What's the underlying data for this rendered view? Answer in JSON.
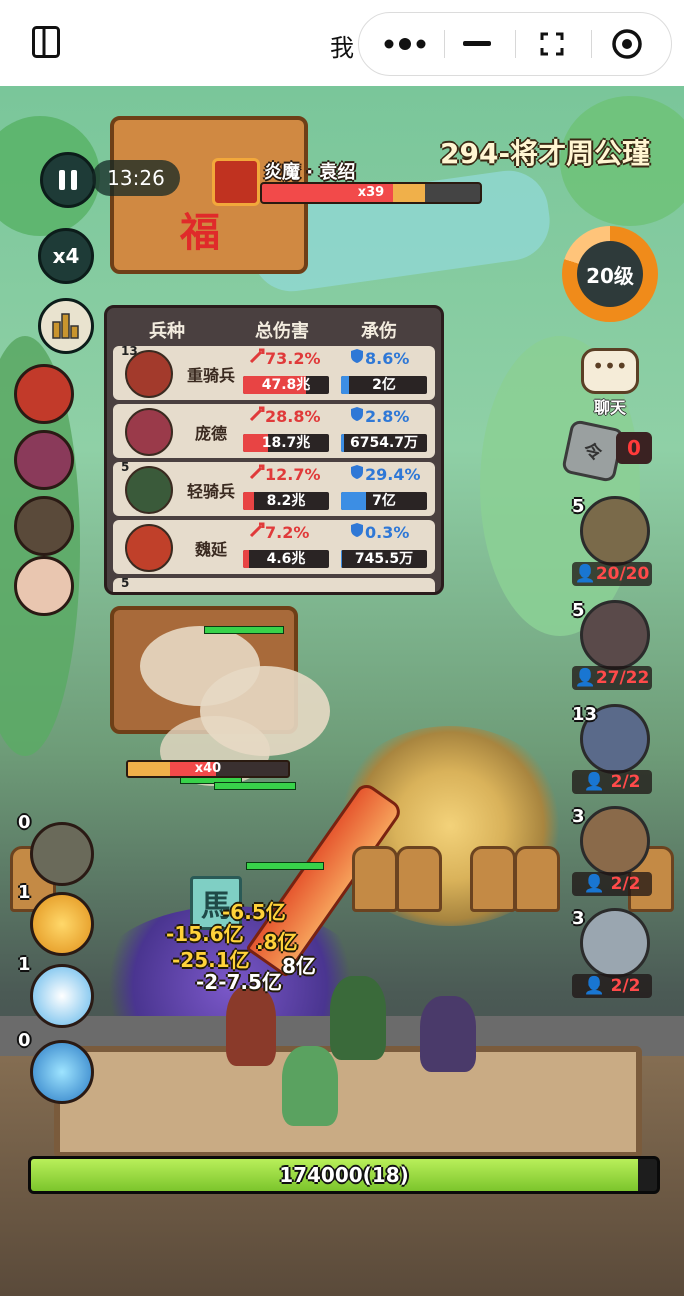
{
  "topbar": {
    "title": "我",
    "menu_icon": "more-dots-icon",
    "minimize_icon": "minimize-icon",
    "close_icon": "record-close-icon"
  },
  "hud": {
    "timer": "13:26",
    "speed_label": "x4",
    "boss": {
      "name": "炎魔 · 袁绍",
      "count": "x39",
      "hp_fraction": 0.6
    },
    "level_title": "294-将才周公瑾",
    "player_level": "20级",
    "chat_label": "聊天",
    "token_count": "0",
    "token_glyph": "令"
  },
  "damage_panel": {
    "headers": [
      "兵种",
      "总伤害",
      "承伤"
    ],
    "rows": [
      {
        "level": "13",
        "name": "重骑兵",
        "dmg_pct": "73.2%",
        "dmg_val": "47.8兆",
        "dmg_fill": 0.73,
        "tank_pct": "8.6%",
        "tank_val": "2亿",
        "tank_fill": 0.09
      },
      {
        "level": "",
        "name": "庞德",
        "dmg_pct": "28.8%",
        "dmg_val": "18.7兆",
        "dmg_fill": 0.29,
        "tank_pct": "2.8%",
        "tank_val": "6754.7万",
        "tank_fill": 0.03
      },
      {
        "level": "5",
        "name": "轻骑兵",
        "dmg_pct": "12.7%",
        "dmg_val": "8.2兆",
        "dmg_fill": 0.13,
        "tank_pct": "29.4%",
        "tank_val": "7亿",
        "tank_fill": 0.29
      },
      {
        "level": "",
        "name": "魏延",
        "dmg_pct": "7.2%",
        "dmg_val": "4.6兆",
        "dmg_fill": 0.07,
        "tank_pct": "0.3%",
        "tank_val": "745.5万",
        "tank_fill": 0.01
      }
    ],
    "partial_row_level": "5"
  },
  "units": [
    {
      "level": "5",
      "cap": "20/20"
    },
    {
      "level": "5",
      "cap": "27/22"
    },
    {
      "level": "13",
      "cap": "2/2"
    },
    {
      "level": "3",
      "cap": "2/2"
    },
    {
      "level": "3",
      "cap": "2/2"
    }
  ],
  "skills": [
    {
      "count": "0"
    },
    {
      "count": "1"
    },
    {
      "count": "1"
    },
    {
      "count": "0"
    }
  ],
  "battlefield": {
    "enemy_count": "x40",
    "enemy_hp_fraction": 0.55,
    "sign_text": "福",
    "banner_text": "馬",
    "damage_numbers": [
      "-6.5亿",
      "-15.6亿",
      ".8亿",
      "-25.1亿",
      "8亿",
      "-2-7.5亿"
    ]
  },
  "base": {
    "hp_text": "174000(18)",
    "hp_fraction": 0.97
  },
  "colors": {
    "accent_orange": "#f08b1a",
    "hp_red": "#f24a4a",
    "hp_green": "#7cc52c",
    "tank_blue": "#3c8ee4"
  }
}
